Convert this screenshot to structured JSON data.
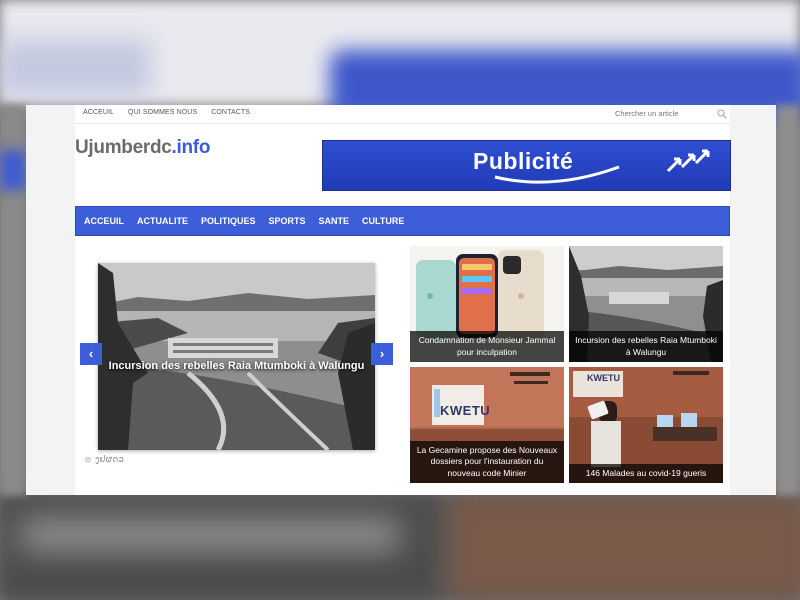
{
  "topbar": {
    "links": [
      "ACCEUIL",
      "QUI SOMMES NOUS",
      "CONTACTS"
    ],
    "search_placeholder": "Chercher un article"
  },
  "logo": {
    "part1": "Ujumberdc",
    "part2": ".info"
  },
  "ad": {
    "text": "Publicité"
  },
  "mainnav": {
    "items": [
      "ACCEUIL",
      "ACTUALITE",
      "POLITIQUES",
      "SPORTS",
      "SANTE",
      "CULTURE"
    ]
  },
  "slider": {
    "caption": "Incursion des rebelles Raia Mtumboki à Walungu",
    "prev_icon": "chevron-left-icon",
    "next_icon": "chevron-right-icon",
    "extra_text": "ງຢຜດວ"
  },
  "articles": [
    {
      "title": "Condamnation de Monsieur Jammal pour inculpation"
    },
    {
      "title": "Incursion des rebelles Raia Mtumboki à Walungu"
    },
    {
      "title": "La Gecamine propose des Nouveaux dossiers pour l'instauration du nouveau code Minier"
    },
    {
      "title": "146 Malades au covid-19 gueris"
    }
  ],
  "image_text": {
    "kwetu": "KWETU"
  },
  "colors": {
    "accent": "#3e5ed9",
    "logo_gray": "#6b6b6b",
    "logo_blue": "#3b5bd8"
  }
}
